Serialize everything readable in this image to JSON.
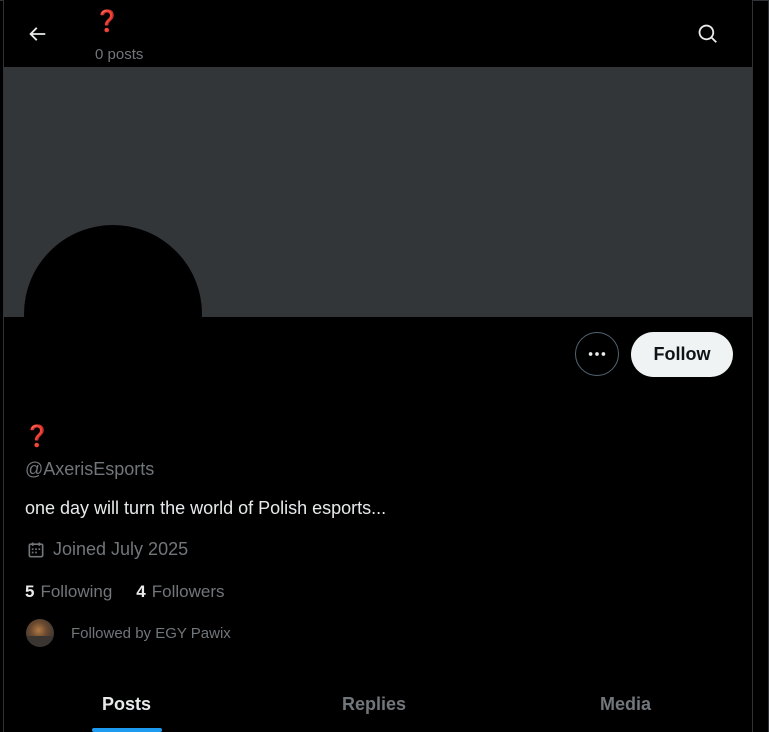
{
  "header": {
    "title": "❓",
    "post_count": "0 posts"
  },
  "profile": {
    "display_name": "❓",
    "handle": "@AxerisEsports",
    "bio": "one day will turn the world of Polish esports...",
    "joined": "Joined July 2025",
    "following_count": "5",
    "following_label": "Following",
    "followers_count": "4",
    "followers_label": "Followers",
    "followed_by": "Followed by EGY Pawix"
  },
  "actions": {
    "follow_label": "Follow"
  },
  "tabs": [
    {
      "label": "Posts",
      "active": true
    },
    {
      "label": "Replies",
      "active": false
    },
    {
      "label": "Media",
      "active": false
    }
  ],
  "icons": {
    "back": "arrow-left-icon",
    "search": "search-icon",
    "more": "more-horizontal-icon",
    "calendar": "calendar-icon"
  },
  "colors": {
    "background": "#000000",
    "banner": "#333639",
    "text_primary": "#e7e9ea",
    "text_secondary": "#71767b",
    "accent": "#1d9bf0",
    "follow_button_bg": "#eff3f4"
  }
}
